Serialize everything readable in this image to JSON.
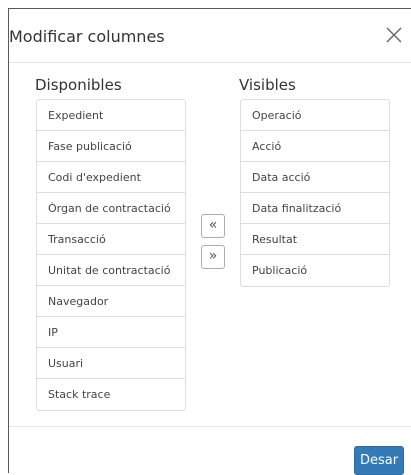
{
  "modal": {
    "title": "Modificar columnes",
    "close_icon": "close-icon"
  },
  "available": {
    "title": "Disponibles",
    "items": [
      "Expedient",
      "Fase publicació",
      "Codi d'expedient",
      "Òrgan de contractació",
      "Transacció",
      "Unitat de contractació",
      "Navegador",
      "IP",
      "Usuari",
      "Stack trace"
    ]
  },
  "visible": {
    "title": "Visibles",
    "items": [
      "Operació",
      "Acció",
      "Data acció",
      "Data finalització",
      "Resultat",
      "Publicació"
    ]
  },
  "controls": {
    "move_left_label": "«",
    "move_right_label": "»"
  },
  "footer": {
    "save_label": "Desar"
  },
  "colors": {
    "primary": "#337ab7",
    "border": "#dddddd",
    "text": "#333333"
  }
}
